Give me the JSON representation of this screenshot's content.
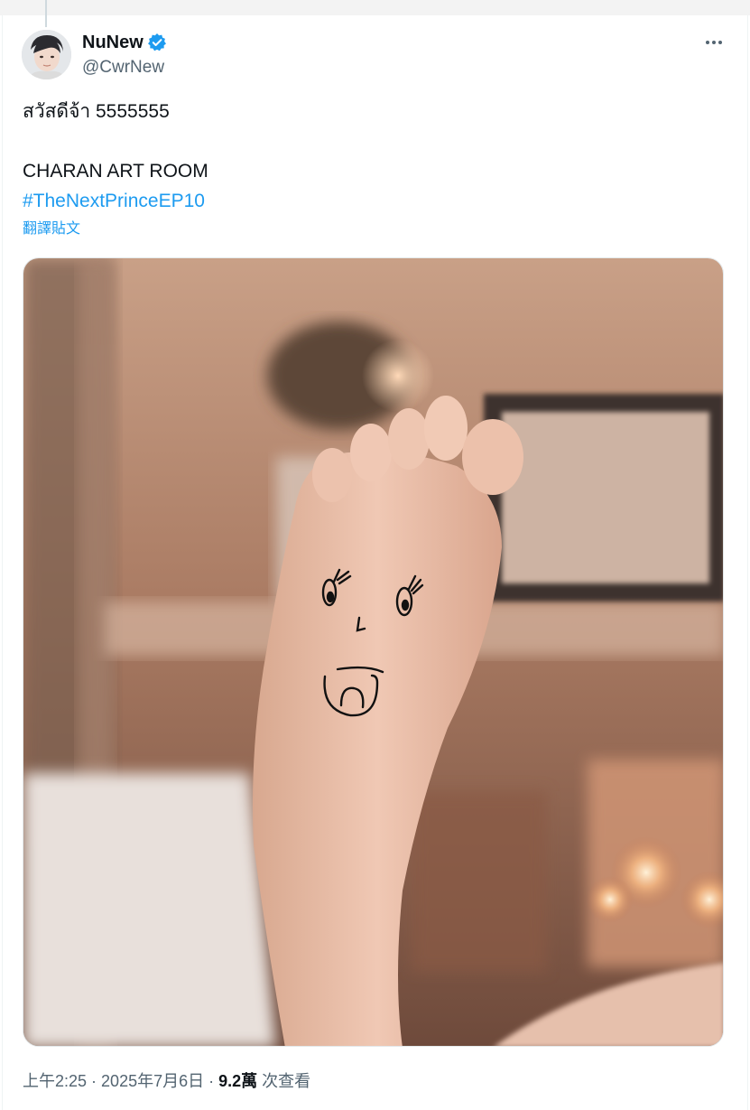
{
  "tweet": {
    "author": {
      "display_name": "NuNew",
      "handle": "@CwrNew",
      "verified_icon": "verified-badge-icon",
      "verified_color": "#1d9bf0"
    },
    "text_line1": "สวัสดีจ้า 5555555",
    "text_line2": "CHARAN ART ROOM",
    "hashtag": "#TheNextPrinceEP10",
    "translate_label": "翻譯貼文",
    "more_icon": "more-options-icon",
    "time": "上午2:25",
    "separator": " · ",
    "date": "2025年7月6日",
    "views_count": "9.2萬",
    "views_label": "次查看"
  },
  "colors": {
    "link": "#1d9bf0",
    "secondary_text": "#536471",
    "primary_text": "#0f1419"
  }
}
